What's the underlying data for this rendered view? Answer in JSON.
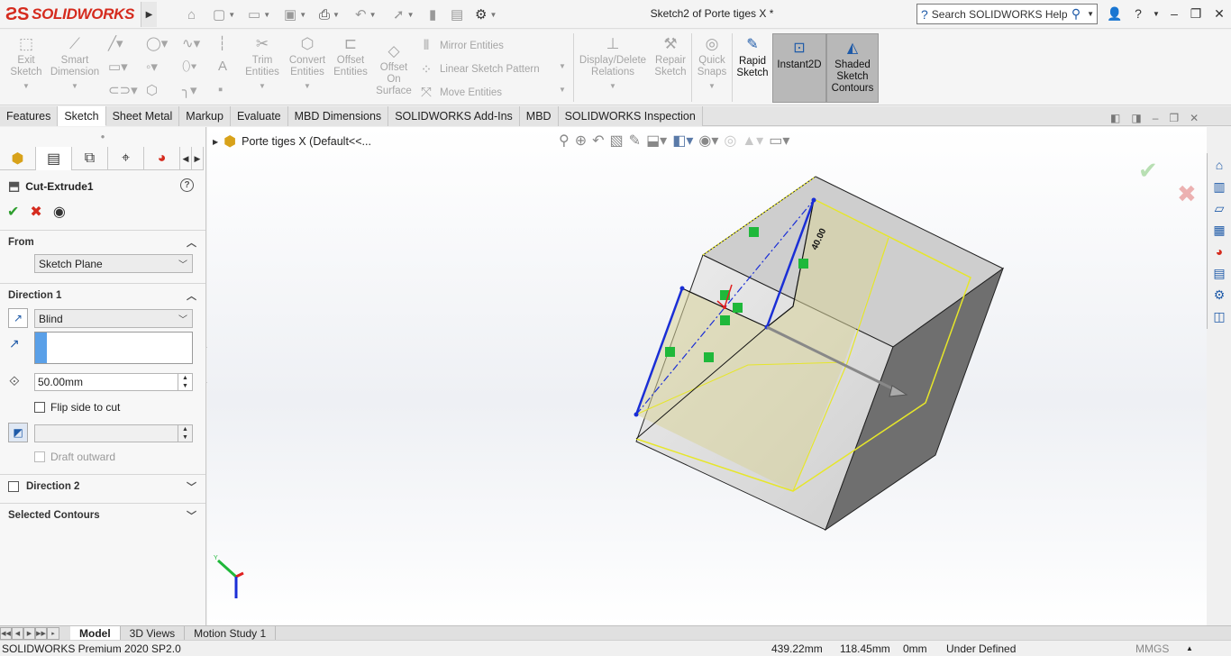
{
  "app": {
    "logo_text": "SOLIDWORKS",
    "doc_title": "Sketch2 of Porte tiges X *"
  },
  "search": {
    "placeholder": "Search SOLIDWORKS Help"
  },
  "ribbon": {
    "exit_sketch": [
      "Exit",
      "Sketch"
    ],
    "smart_dimension": [
      "Smart",
      "Dimension"
    ],
    "trim_entities": [
      "Trim",
      "Entities"
    ],
    "convert_entities": [
      "Convert",
      "Entities"
    ],
    "offset_entities": [
      "Offset",
      "Entities"
    ],
    "offset_on_surface": [
      "Offset",
      "On",
      "Surface"
    ],
    "mirror_entities": "Mirror Entities",
    "linear_sketch_pattern": "Linear Sketch Pattern",
    "move_entities": "Move Entities",
    "display_delete_relations": [
      "Display/Delete",
      "Relations"
    ],
    "repair_sketch": [
      "Repair",
      "Sketch"
    ],
    "quick_snaps": [
      "Quick",
      "Snaps"
    ],
    "rapid_sketch": [
      "Rapid",
      "Sketch"
    ],
    "instant2d": "Instant2D",
    "shaded_sketch_contours": [
      "Shaded",
      "Sketch",
      "Contours"
    ]
  },
  "tabs": [
    "Features",
    "Sketch",
    "Sheet Metal",
    "Markup",
    "Evaluate",
    "MBD Dimensions",
    "SOLIDWORKS Add-Ins",
    "MBD",
    "SOLIDWORKS Inspection"
  ],
  "active_tab": "Sketch",
  "property_manager": {
    "feature_name": "Cut-Extrude1",
    "from": {
      "label": "From",
      "value": "Sketch Plane"
    },
    "direction1": {
      "label": "Direction 1",
      "end_condition": "Blind",
      "depth": "50.00mm",
      "flip_side_label": "Flip side to cut",
      "draft_outward_label": "Draft outward"
    },
    "direction2": {
      "label": "Direction 2"
    },
    "selected_contours": {
      "label": "Selected Contours"
    }
  },
  "tree": {
    "item": "Porte tiges X  (Default<<..."
  },
  "model": {
    "dimension_label": "40.00"
  },
  "bottom_tabs": [
    "Model",
    "3D Views",
    "Motion Study 1"
  ],
  "status": {
    "product": "SOLIDWORKS Premium 2020 SP2.0",
    "x": "439.22mm",
    "y": "118.45mm",
    "z": "0mm",
    "state": "Under Defined",
    "units": "MMGS"
  },
  "colors": {
    "accent": "#1e5aa8",
    "brand": "#d52b1e",
    "sketch_blue": "#1a2ed6",
    "contour_yellow": "#e8e830",
    "relation_green": "#1fb83a"
  }
}
